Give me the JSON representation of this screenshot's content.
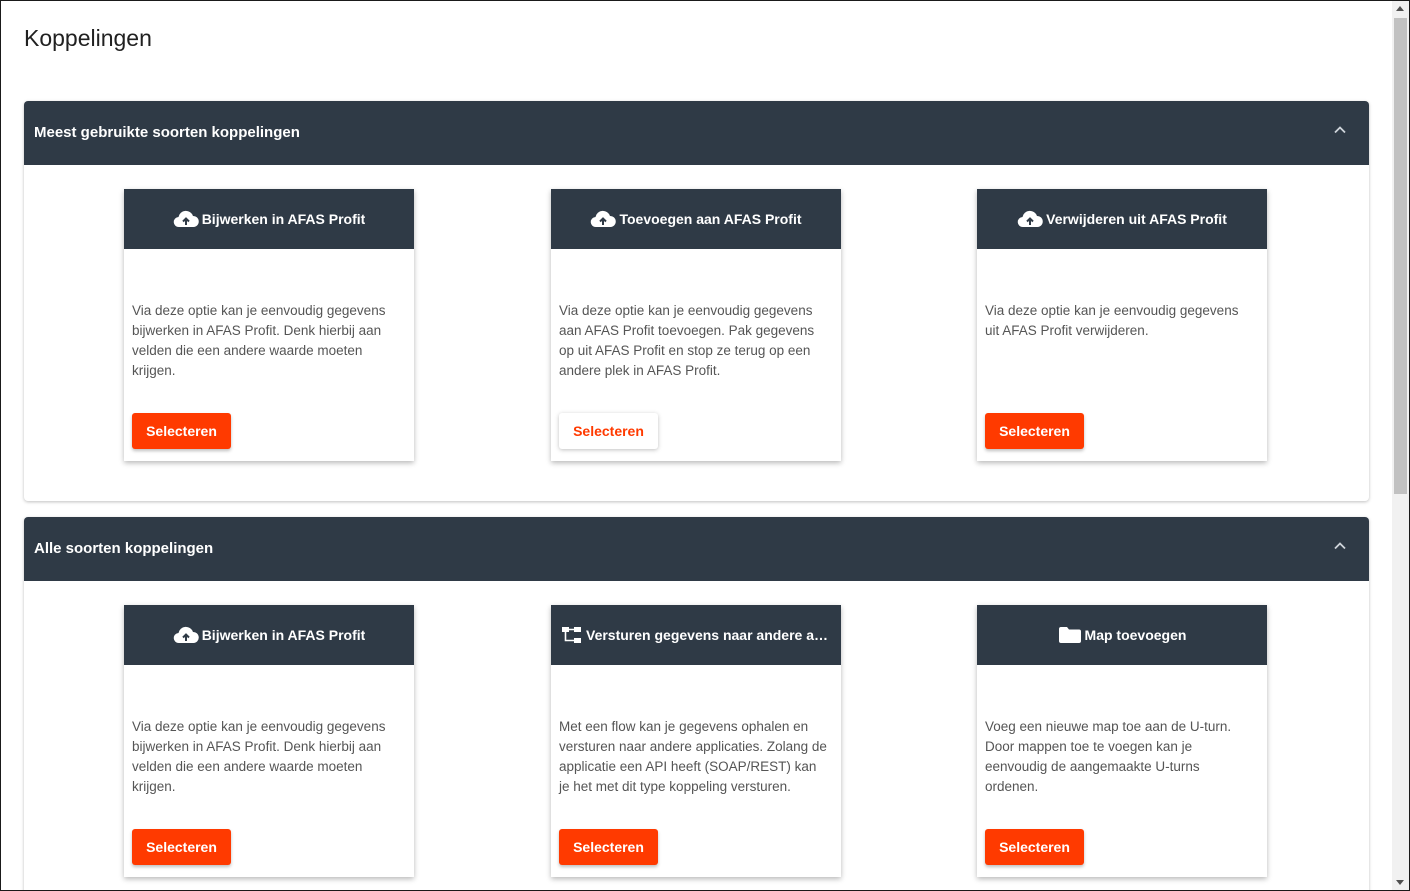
{
  "page": {
    "title": "Koppelingen"
  },
  "sections": [
    {
      "title": "Meest gebruikte soorten koppelingen",
      "cards": [
        {
          "title": "Bijwerken in AFAS Profit",
          "icon": "cloud-upload-icon",
          "text": "Via deze optie kan je eenvoudig gegevens bijwerken in AFAS Profit. Denk hierbij aan velden die een andere waarde moeten krijgen.",
          "button": "Selecteren",
          "button_style": "primary"
        },
        {
          "title": "Toevoegen aan AFAS Profit",
          "icon": "cloud-upload-icon",
          "text": "Via deze optie kan je eenvoudig gegevens aan AFAS Profit toevoegen. Pak gegevens op uit AFAS Profit en stop ze terug op een andere plek in AFAS Profit.",
          "button": "Selecteren",
          "button_style": "outline"
        },
        {
          "title": "Verwijderen uit AFAS Profit",
          "icon": "cloud-upload-icon",
          "text": "Via deze optie kan je eenvoudig gegevens uit AFAS Profit verwijderen.",
          "button": "Selecteren",
          "button_style": "primary"
        }
      ]
    },
    {
      "title": "Alle soorten koppelingen",
      "cards": [
        {
          "title": "Bijwerken in AFAS Profit",
          "icon": "cloud-upload-icon",
          "text": "Via deze optie kan je eenvoudig gegevens bijwerken in AFAS Profit. Denk hierbij aan velden die een andere waarde moeten krijgen.",
          "button": "Selecteren",
          "button_style": "primary"
        },
        {
          "title": "Versturen gegevens naar andere applicaties",
          "icon": "flow-icon",
          "text": "Met een flow kan je gegevens ophalen en versturen naar andere applicaties. Zolang de applicatie een API heeft (SOAP/REST) kan je het met dit type koppeling versturen.",
          "button": "Selecteren",
          "button_style": "primary"
        },
        {
          "title": "Map toevoegen",
          "icon": "folder-icon",
          "text": "Voeg een nieuwe map toe aan de U-turn. Door mappen toe te voegen kan je eenvoudig de aangemaakte U-turns ordenen.",
          "button": "Selecteren",
          "button_style": "primary"
        }
      ]
    }
  ],
  "colors": {
    "header_bg": "#2f3a46",
    "accent": "#ff3a00"
  }
}
